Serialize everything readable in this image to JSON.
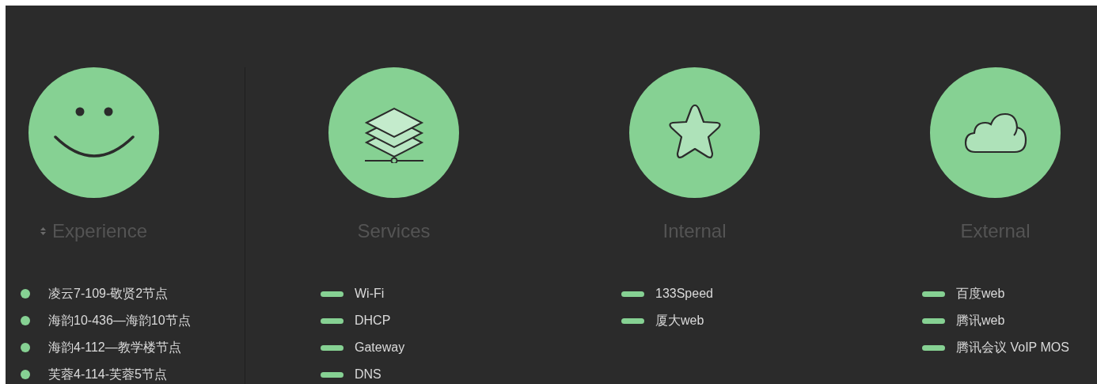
{
  "columns": [
    {
      "heading": "Experience",
      "sortable": true,
      "kind": "dot",
      "items": [
        "凌云7-109-敬贤2节点",
        "海韵10-436—海韵10节点",
        "海韵4-112—教学楼节点",
        "芙蓉4-114-芙蓉5节点"
      ]
    },
    {
      "heading": "Services",
      "sortable": false,
      "kind": "dash",
      "items": [
        "Wi-Fi",
        "DHCP",
        "Gateway",
        "DNS"
      ]
    },
    {
      "heading": "Internal",
      "sortable": false,
      "kind": "dash",
      "items": [
        "133Speed",
        "厦大web"
      ]
    },
    {
      "heading": "External",
      "sortable": false,
      "kind": "dash",
      "items": [
        "百度web",
        "腾讯web",
        "腾讯会议 VoIP MOS"
      ]
    }
  ]
}
